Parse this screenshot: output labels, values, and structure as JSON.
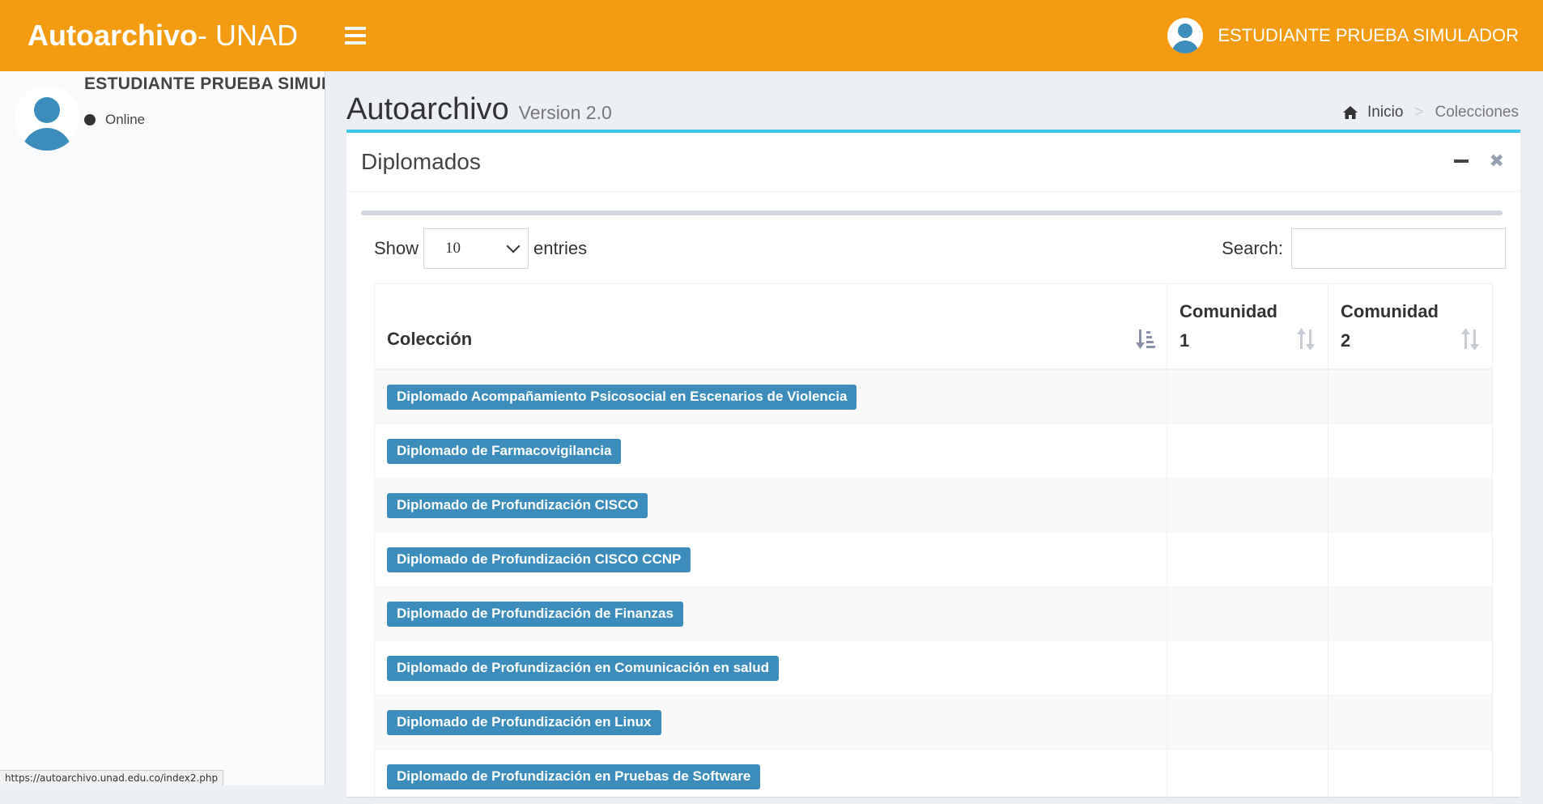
{
  "header": {
    "brand_bold": "Autoarchivo",
    "brand_rest": " - UNAD",
    "user_name": "ESTUDIANTE PRUEBA SIMULADOR"
  },
  "sidebar": {
    "user_name": "ESTUDIANTE PRUEBA SIMULADOR",
    "status": "Online"
  },
  "content": {
    "title": "Autoarchivo",
    "version": "Version 2.0",
    "breadcrumb": [
      "Inicio",
      "Colecciones"
    ]
  },
  "box": {
    "title": "Diplomados",
    "show_label": "Show",
    "entries_value": "10",
    "entries_label": "entries",
    "search_label": "Search:",
    "search_value": "",
    "columns": [
      "Colección",
      "Comunidad 1",
      "Comunidad 2"
    ],
    "rows": [
      {
        "coleccion": "Diplomado Acompañamiento Psicosocial en Escenarios de Violencia",
        "comunidad1": "",
        "comunidad2": ""
      },
      {
        "coleccion": "Diplomado de Farmacovigilancia",
        "comunidad1": "",
        "comunidad2": ""
      },
      {
        "coleccion": "Diplomado de Profundización CISCO",
        "comunidad1": "",
        "comunidad2": ""
      },
      {
        "coleccion": "Diplomado de Profundización CISCO CCNP",
        "comunidad1": "",
        "comunidad2": ""
      },
      {
        "coleccion": "Diplomado de Profundización de Finanzas",
        "comunidad1": "",
        "comunidad2": ""
      },
      {
        "coleccion": "Diplomado de Profundización en Comunicación en salud",
        "comunidad1": "",
        "comunidad2": ""
      },
      {
        "coleccion": "Diplomado de Profundización en Linux",
        "comunidad1": "",
        "comunidad2": ""
      },
      {
        "coleccion": "Diplomado de Profundización en Pruebas de Software",
        "comunidad1": "",
        "comunidad2": ""
      }
    ]
  },
  "statusbar": {
    "url": "https://autoarchivo.unad.edu.co/index2.php"
  },
  "colors": {
    "header_bg": "#f39c12",
    "box_accent": "#3cc4e9",
    "label_bg": "#3c8dbc"
  }
}
